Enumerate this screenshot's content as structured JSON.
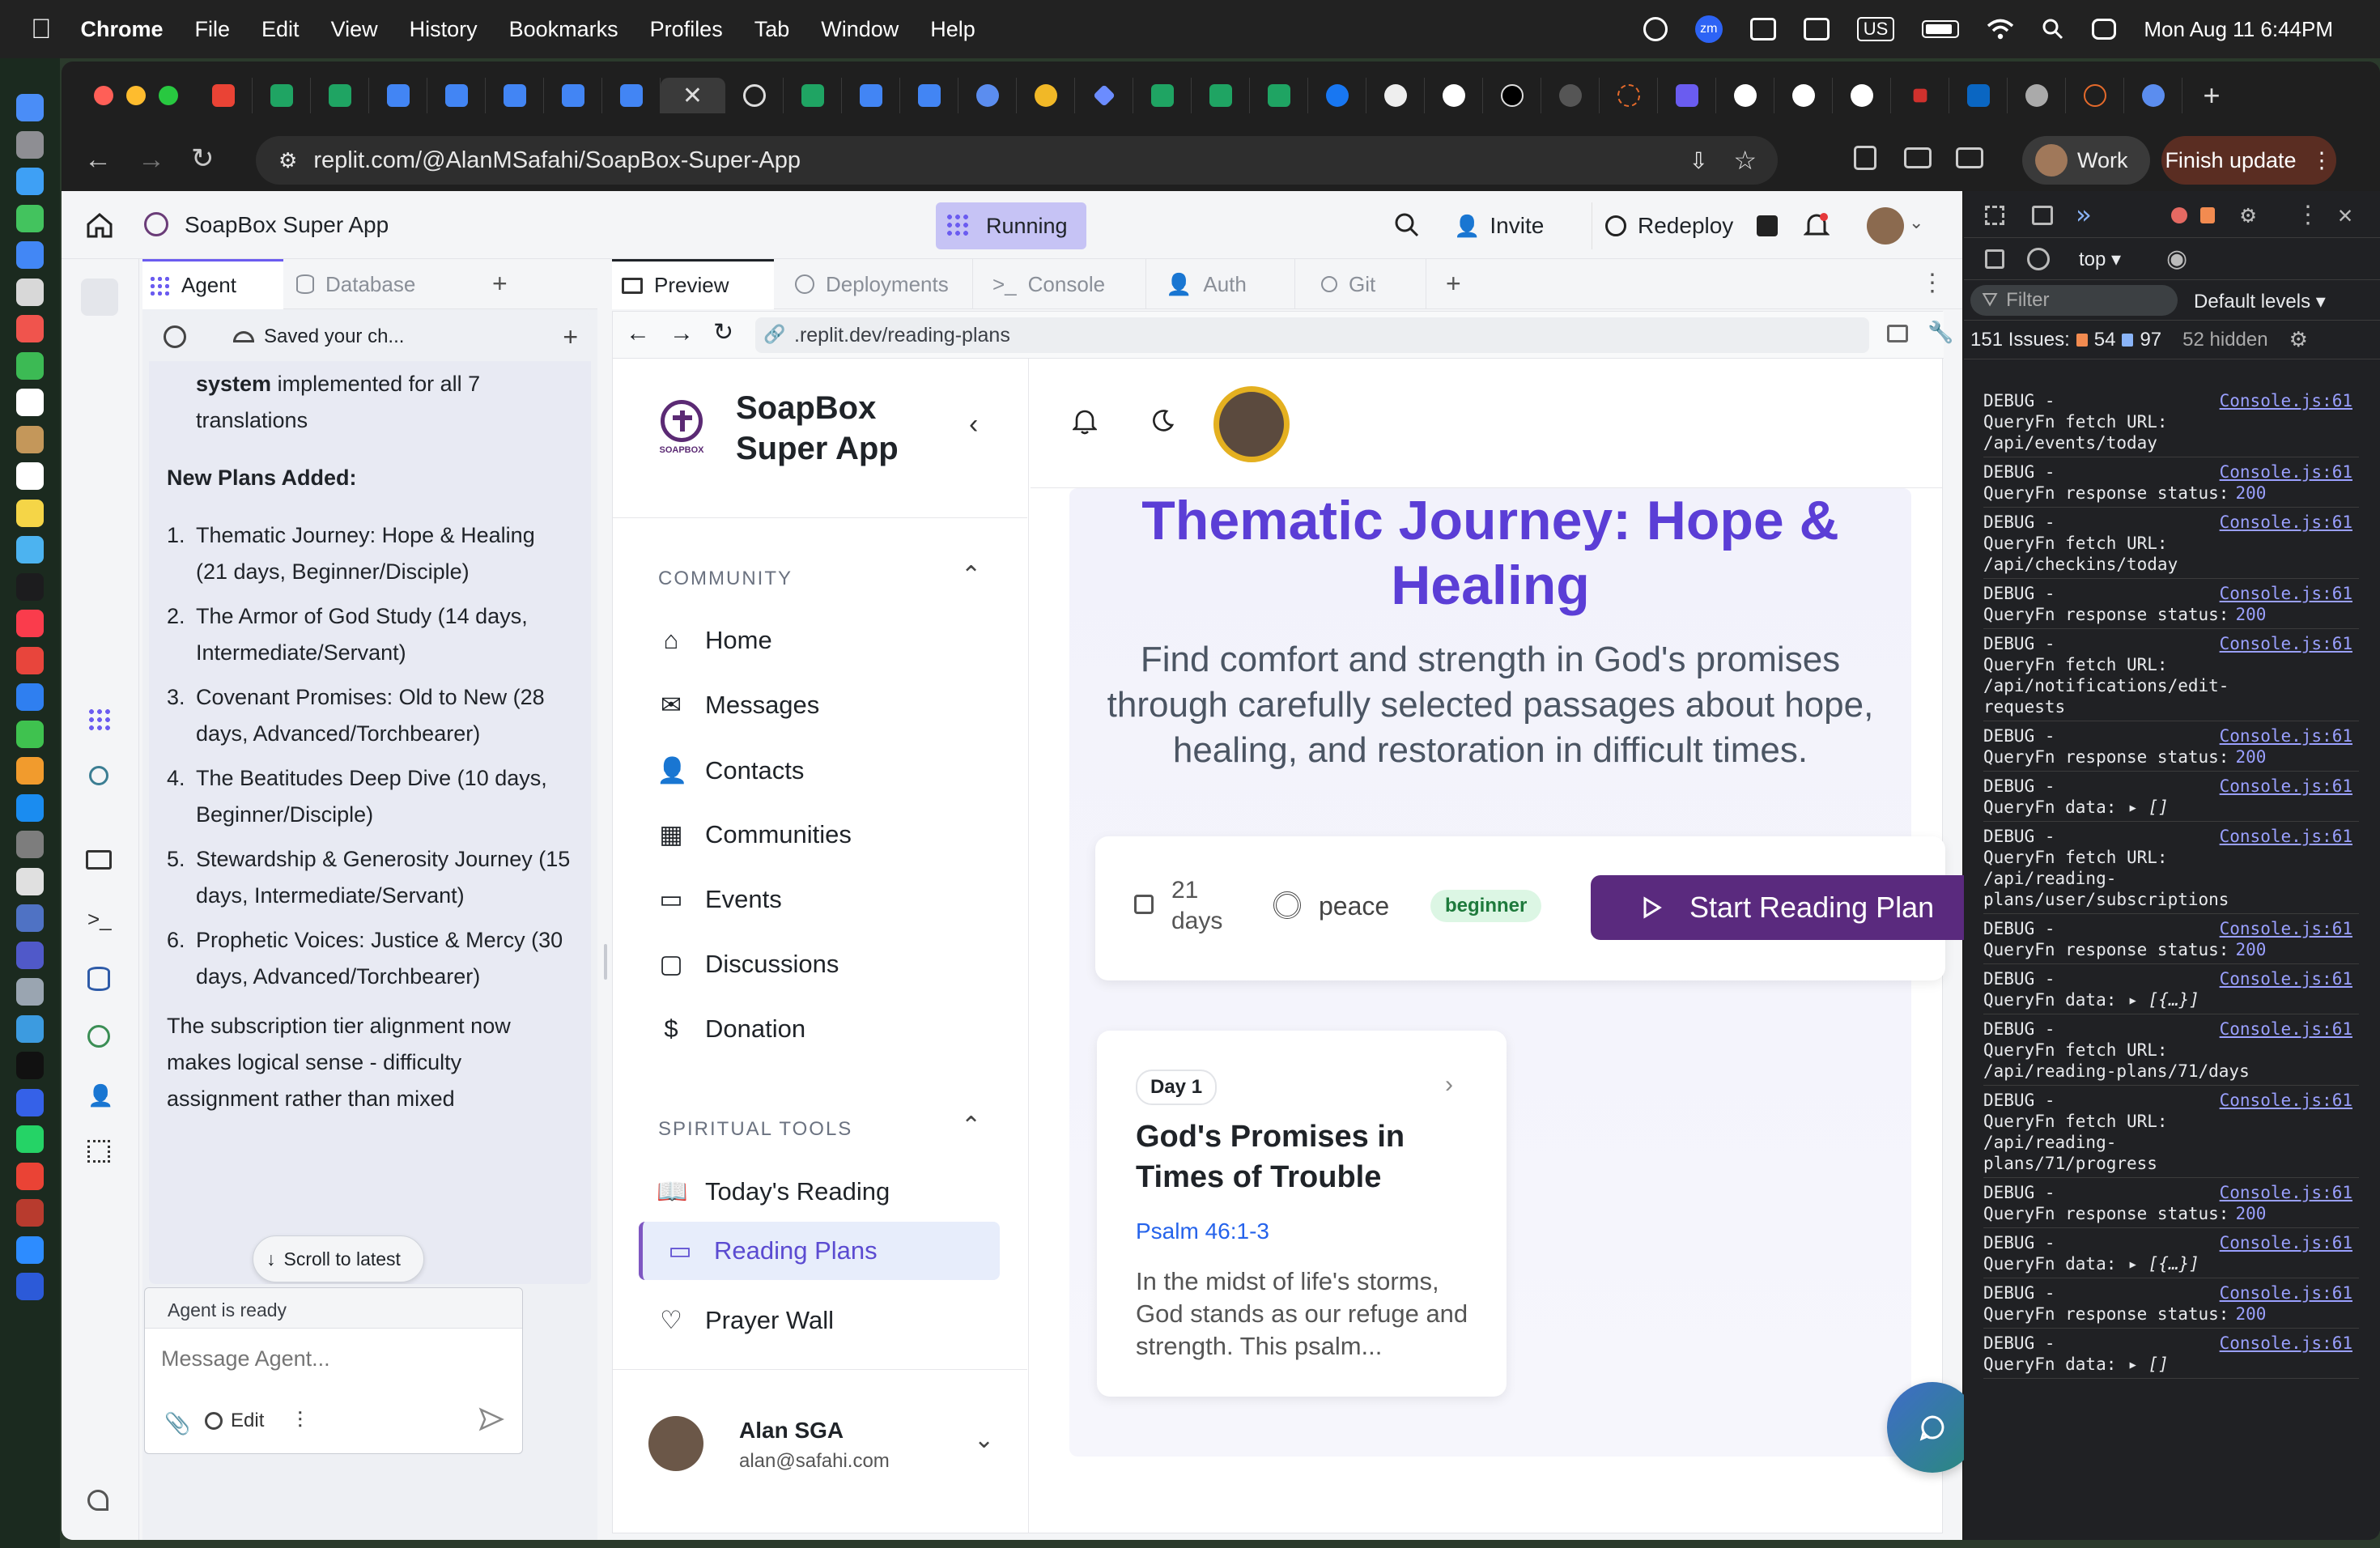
{
  "menubar": {
    "app": "Chrome",
    "items": [
      "File",
      "Edit",
      "View",
      "History",
      "Bookmarks",
      "Profiles",
      "Tab",
      "Window",
      "Help"
    ],
    "keyboard": "US",
    "datetime": "Mon Aug 11  6:44PM"
  },
  "browser": {
    "url": "replit.com/@AlanMSafahi/SoapBox-Super-App",
    "profile": "Work",
    "finish_update": "Finish update"
  },
  "replit": {
    "project_name": "SoapBox Super App",
    "run_status": "Running",
    "invite": "Invite",
    "redeploy": "Redeploy",
    "left_tabs": {
      "agent": "Agent",
      "database": "Database"
    },
    "agent_toolbar": {
      "saved": "Saved your ch..."
    },
    "agent_msg": {
      "lead_bold": "system",
      "lead_rest": " implemented for all 7 translations",
      "heading": "New Plans Added:",
      "plans": [
        {
          "n": "1.",
          "text": "Thematic Journey: Hope & Healing (21 days, Beginner/Disciple)"
        },
        {
          "n": "2.",
          "text": "The Armor of God Study (14 days, Intermediate/Servant)"
        },
        {
          "n": "3.",
          "text": "Covenant Promises: Old to New (28 days, Advanced/Torchbearer)"
        },
        {
          "n": "4.",
          "text": "The Beatitudes Deep Dive (10 days, Beginner/Disciple)"
        },
        {
          "n": "5.",
          "text": "Stewardship & Generosity Journey (15 days, Intermediate/Servant)"
        },
        {
          "n": "6.",
          "text": "Prophetic Voices: Justice & Mercy (30 days, Advanced/Torchbearer)"
        }
      ],
      "closing": "The subscription tier alignment now makes logical sense - difficulty assignment rather than mixed",
      "scroll_latest": "Scroll to latest"
    },
    "agent_status": "Agent is ready",
    "message_placeholder": "Message Agent...",
    "edit_label": "Edit",
    "ws_tabs": [
      "Preview",
      "Deployments",
      "Console",
      "Auth",
      "Git"
    ],
    "preview_url": ".replit.dev/reading-plans"
  },
  "soapbox": {
    "app_name_line1": "SoapBox",
    "app_name_line2": "Super App",
    "logo_text": "SOAPBOX",
    "section_community": "COMMUNITY",
    "community_items": [
      "Home",
      "Messages",
      "Contacts",
      "Communities",
      "Events",
      "Discussions",
      "Donation"
    ],
    "section_tools": "SPIRITUAL TOOLS",
    "tools_items": [
      "Today's Reading",
      "Reading Plans",
      "Prayer Wall"
    ],
    "user": {
      "name": "Alan SGA",
      "email": "alan@safahi.com"
    },
    "plan": {
      "title": "Thematic Journey: Hope & Healing",
      "description": "Find comfort and strength in God's promises through carefully selected passages about hope, healing, and restoration in difficult times.",
      "days_num": "21",
      "days_word": "days",
      "theme": "peace",
      "level": "beginner",
      "start": "Start Reading Plan"
    },
    "day_card": {
      "badge": "Day 1",
      "title": "God's Promises in Times of Trouble",
      "ref": "Psalm 46:1-3",
      "excerpt": "In the midst of life's storms, God stands as our refuge and strength. This psalm..."
    }
  },
  "devtools": {
    "context": "top",
    "filter": "Filter",
    "levels": "Default levels",
    "issues_label": "151 Issues:",
    "warn_count": "54",
    "info_count": "97",
    "hidden": "52 hidden",
    "logs": [
      {
        "l1": "DEBUG -",
        "l2": "QueryFn fetch URL:",
        "l3": "/api/events/today"
      },
      {
        "l1": "DEBUG -",
        "l2": "QueryFn response status:",
        "status": "200"
      },
      {
        "l1": "DEBUG -",
        "l2": "QueryFn fetch URL:",
        "l3": "/api/checkins/today"
      },
      {
        "l1": "DEBUG -",
        "l2": "QueryFn response status:",
        "status": "200"
      },
      {
        "l1": "DEBUG -",
        "l2": "QueryFn fetch URL:",
        "l3": "/api/notifications/edit-",
        "l4": "requests"
      },
      {
        "l1": "DEBUG -",
        "l2": "QueryFn response status:",
        "status": "200"
      },
      {
        "l1": "DEBUG -",
        "l2": "QueryFn data:",
        "obj": "▸ []"
      },
      {
        "l1": "DEBUG -",
        "l2": "QueryFn fetch URL:",
        "l3": "/api/reading-",
        "l4": "plans/user/subscriptions"
      },
      {
        "l1": "DEBUG -",
        "l2": "QueryFn response status:",
        "status": "200"
      },
      {
        "l1": "DEBUG -",
        "l2": "QueryFn data:",
        "obj": "▸ [{…}]"
      },
      {
        "l1": "DEBUG -",
        "l2": "QueryFn fetch URL:",
        "l3": "/api/reading-plans/71/days"
      },
      {
        "l1": "DEBUG -",
        "l2": "QueryFn fetch URL:",
        "l3": "/api/reading-",
        "l4": "plans/71/progress"
      },
      {
        "l1": "DEBUG -",
        "l2": "QueryFn response status:",
        "status": "200"
      },
      {
        "l1": "DEBUG -",
        "l2": "QueryFn data:",
        "obj": "▸ [{…}]"
      },
      {
        "l1": "DEBUG -",
        "l2": "QueryFn response status:",
        "status": "200"
      },
      {
        "l1": "DEBUG -",
        "l2": "QueryFn data:",
        "obj": "▸ []"
      }
    ],
    "src": "Console.js:61"
  }
}
